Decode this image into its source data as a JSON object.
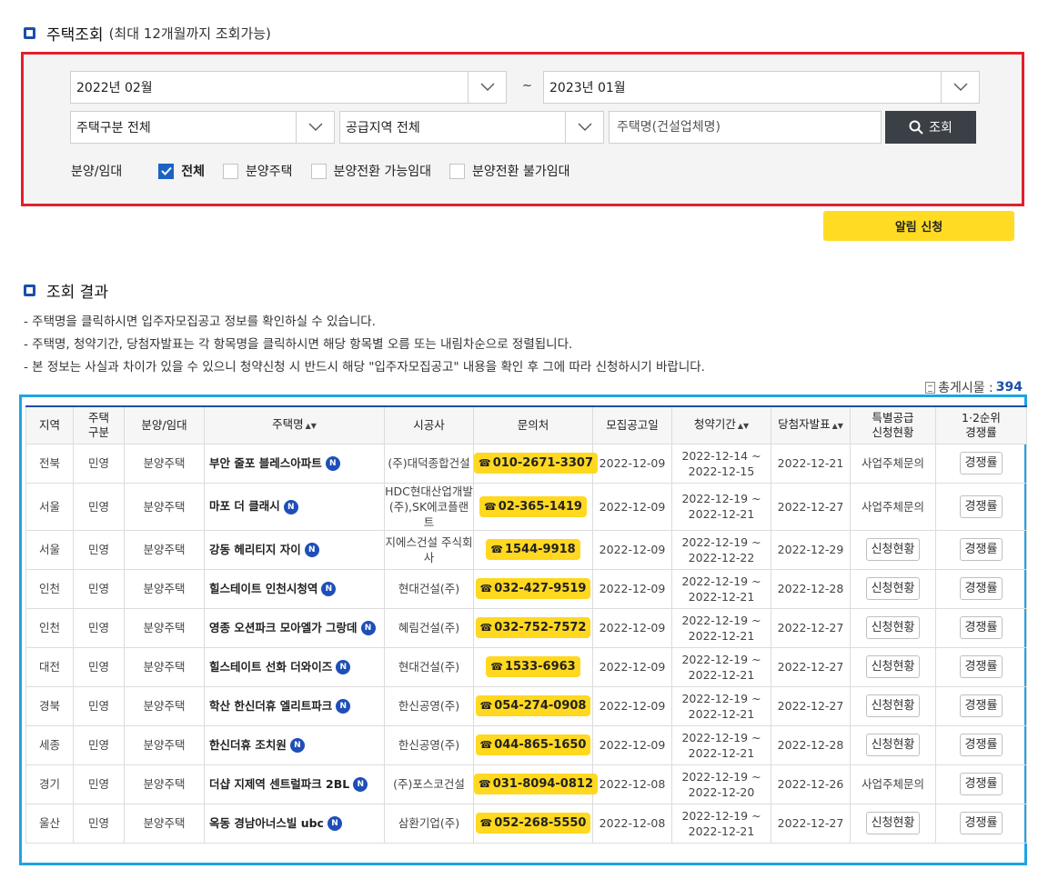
{
  "search_section": {
    "title": "주택조회",
    "subtitle": "(최대 12개월까지 조회가능)"
  },
  "filters": {
    "start_month": "2022년 02월",
    "tilde": "~",
    "end_month": "2023년 01월",
    "house_type": "주택구분 전체",
    "region": "공급지역 전체",
    "name_placeholder": "주택명(건설업체명)",
    "search_label": "조회",
    "category_label": "분양/임대",
    "checkboxes": [
      {
        "label": "전체",
        "checked": true
      },
      {
        "label": "분양주택",
        "checked": false
      },
      {
        "label": "분양전환 가능임대",
        "checked": false
      },
      {
        "label": "분양전환 불가임대",
        "checked": false
      }
    ]
  },
  "alert_button": "알림 신청",
  "result_section": {
    "title": "조회 결과",
    "notes": [
      "-  주택명을 클릭하시면 입주자모집공고 정보를 확인하실 수 있습니다.",
      "-  주택명, 청약기간, 당첨자발표는 각 항목명을 클릭하시면 해당 항목별 오름 또는 내림차순으로 정렬됩니다.",
      "-  본 정보는 사실과 차이가 있을 수 있으니 청약신청 시 반드시 해당 \"입주자모집공고\" 내용을 확인 후 그에 따라 신청하시기 바랍니다."
    ],
    "total_label": "총게시물 :",
    "total_count": "394"
  },
  "table": {
    "headers": {
      "region": "지역",
      "house_type": "주택\n구분",
      "sale_rent": "분양/임대",
      "name": "주택명",
      "builder": "시공사",
      "contact": "문의처",
      "notice_date": "모집공고일",
      "period": "청약기간",
      "winner_date": "당첨자발표",
      "special": "특별공급\n신청현황",
      "competition": "1·2순위\n경쟁률"
    },
    "sort_glyph": "▲▼",
    "new_badge": "N",
    "tel_glyph": "☎",
    "rows": [
      {
        "region": "전북",
        "type": "민영",
        "sale": "분양주택",
        "name": "부안 줄포 블레스아파트",
        "builder": "(주)대덕종합건설",
        "phone": "010-2671-3307",
        "notice": "2022-12-09",
        "period": "2022-12-14 ~\n2022-12-15",
        "winner": "2022-12-21",
        "special": "사업주체문의",
        "special_btn": false,
        "comp": "경쟁률"
      },
      {
        "region": "서울",
        "type": "민영",
        "sale": "분양주택",
        "name": "마포 더 클래시",
        "builder": "HDC현대산업개발(주),SK에코플랜트",
        "phone": "02-365-1419",
        "notice": "2022-12-09",
        "period": "2022-12-19 ~\n2022-12-21",
        "winner": "2022-12-27",
        "special": "사업주체문의",
        "special_btn": false,
        "comp": "경쟁률"
      },
      {
        "region": "서울",
        "type": "민영",
        "sale": "분양주택",
        "name": "강동 헤리티지 자이",
        "builder": "지에스건설 주식회사",
        "phone": "1544-9918",
        "notice": "2022-12-09",
        "period": "2022-12-19 ~\n2022-12-22",
        "winner": "2022-12-29",
        "special": "신청현황",
        "special_btn": true,
        "comp": "경쟁률"
      },
      {
        "region": "인천",
        "type": "민영",
        "sale": "분양주택",
        "name": "힐스테이트 인천시청역",
        "builder": "현대건설(주)",
        "phone": "032-427-9519",
        "notice": "2022-12-09",
        "period": "2022-12-19 ~\n2022-12-21",
        "winner": "2022-12-28",
        "special": "신청현황",
        "special_btn": true,
        "comp": "경쟁률"
      },
      {
        "region": "인천",
        "type": "민영",
        "sale": "분양주택",
        "name": "영종 오션파크 모아엘가 그랑데",
        "builder": "혜림건설(주)",
        "phone": "032-752-7572",
        "notice": "2022-12-09",
        "period": "2022-12-19 ~\n2022-12-21",
        "winner": "2022-12-27",
        "special": "신청현황",
        "special_btn": true,
        "comp": "경쟁률"
      },
      {
        "region": "대전",
        "type": "민영",
        "sale": "분양주택",
        "name": "힐스테이트 선화 더와이즈",
        "builder": "현대건설(주)",
        "phone": "1533-6963",
        "notice": "2022-12-09",
        "period": "2022-12-19 ~\n2022-12-21",
        "winner": "2022-12-27",
        "special": "신청현황",
        "special_btn": true,
        "comp": "경쟁률"
      },
      {
        "region": "경북",
        "type": "민영",
        "sale": "분양주택",
        "name": "학산 한신더휴 엘리트파크",
        "builder": "한신공영(주)",
        "phone": "054-274-0908",
        "notice": "2022-12-09",
        "period": "2022-12-19 ~\n2022-12-21",
        "winner": "2022-12-27",
        "special": "신청현황",
        "special_btn": true,
        "comp": "경쟁률"
      },
      {
        "region": "세종",
        "type": "민영",
        "sale": "분양주택",
        "name": "한신더휴 조치원",
        "builder": "한신공영(주)",
        "phone": "044-865-1650",
        "notice": "2022-12-09",
        "period": "2022-12-19 ~\n2022-12-21",
        "winner": "2022-12-28",
        "special": "신청현황",
        "special_btn": true,
        "comp": "경쟁률"
      },
      {
        "region": "경기",
        "type": "민영",
        "sale": "분양주택",
        "name": "더샵 지제역 센트럴파크 2BL",
        "builder": "(주)포스코건설",
        "phone": "031-8094-0812",
        "notice": "2022-12-08",
        "period": "2022-12-19 ~\n2022-12-20",
        "winner": "2022-12-26",
        "special": "사업주체문의",
        "special_btn": false,
        "comp": "경쟁률"
      },
      {
        "region": "울산",
        "type": "민영",
        "sale": "분양주택",
        "name": "옥동 경남아너스빌 ubc",
        "builder": "삼환기업(주)",
        "phone": "052-268-5550",
        "notice": "2022-12-08",
        "period": "2022-12-19 ~\n2022-12-21",
        "winner": "2022-12-27",
        "special": "신청현황",
        "special_btn": true,
        "comp": "경쟁률"
      }
    ]
  },
  "colors": {
    "accent_blue": "#1b4fa8",
    "yellow": "#ffd81f",
    "red_outline": "#e3202a",
    "cyan_outline": "#1ea4e4"
  }
}
